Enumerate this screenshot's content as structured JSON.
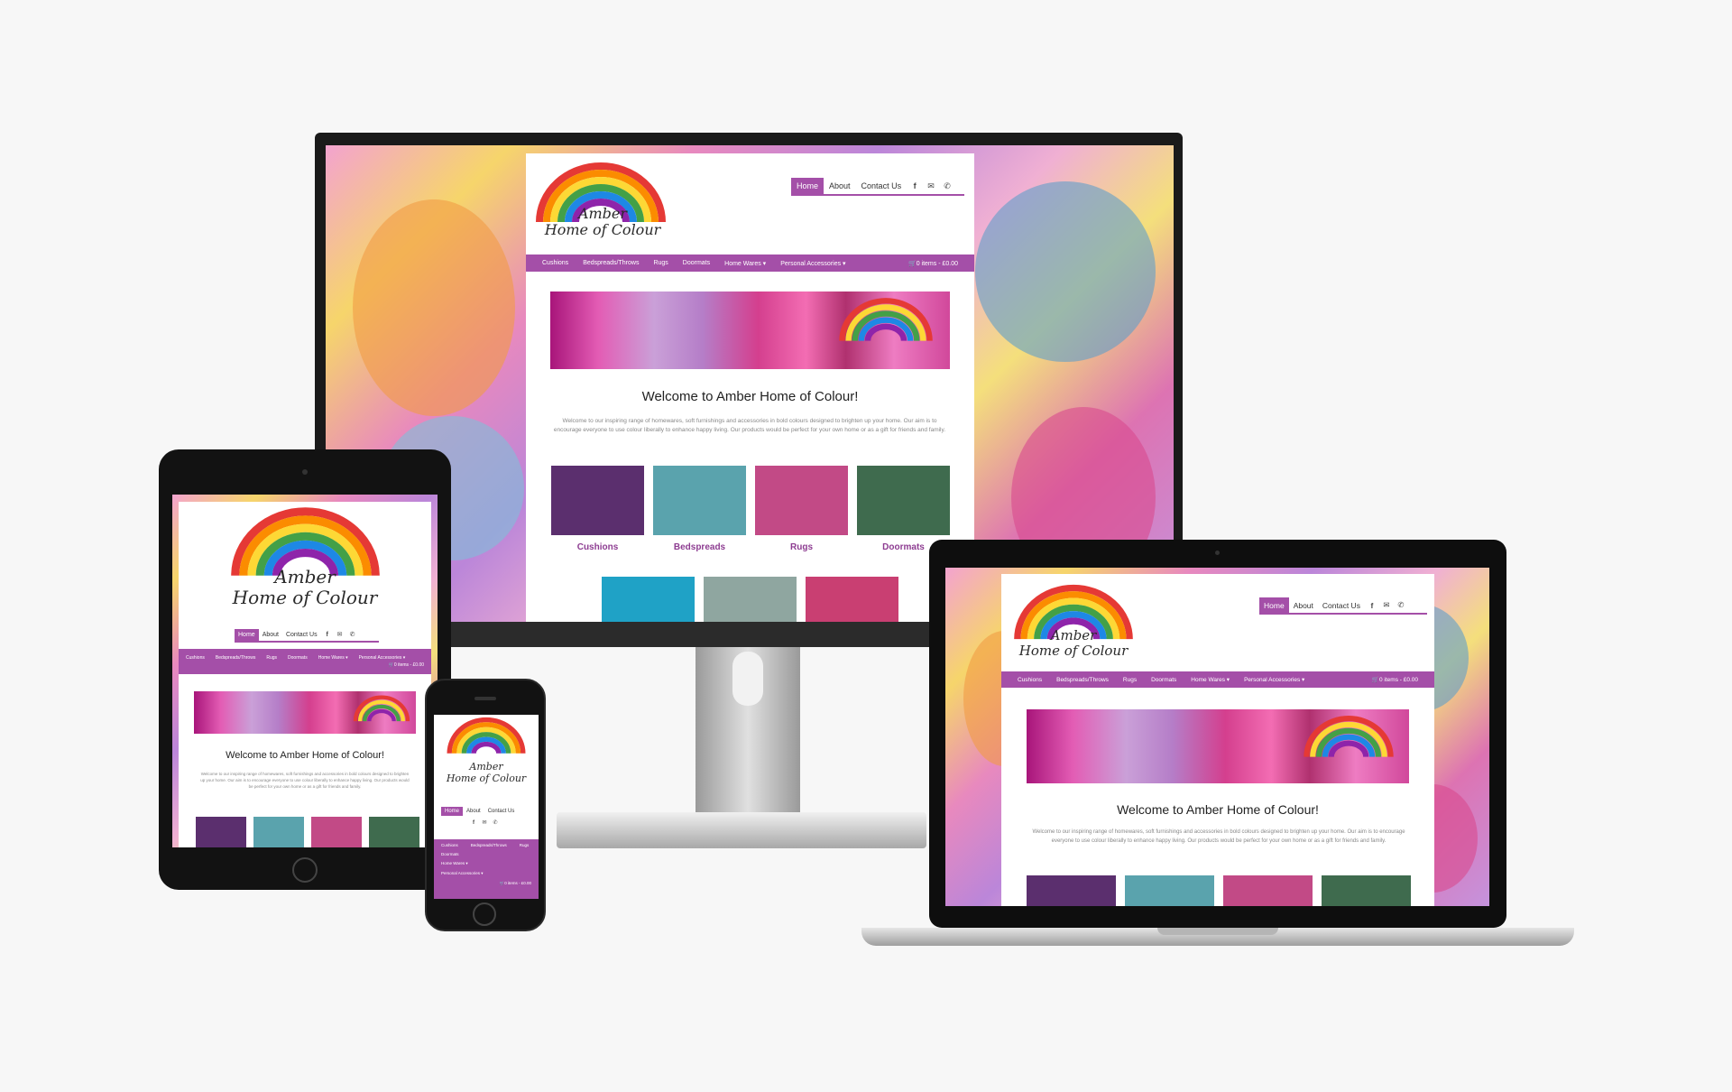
{
  "site": {
    "logo_line1": "Amber",
    "logo_line2": "Home of Colour",
    "nav": [
      {
        "label": "Home",
        "active": true
      },
      {
        "label": "About",
        "active": false
      },
      {
        "label": "Contact Us",
        "active": false
      }
    ],
    "nav_icons": [
      "facebook-icon",
      "envelope-icon",
      "phone-icon"
    ],
    "categories": [
      "Cushions",
      "Bedspreads/Throws",
      "Rugs",
      "Doormats",
      "Home Wares ▾",
      "Personal Accessories ▾"
    ],
    "cart": "🛒0 items - £0.00",
    "welcome_title": "Welcome to Amber Home of Colour!",
    "intro": "Welcome to our inspiring range of homewares, soft furnishings and accessories in bold colours designed to brighten up your home. Our aim is to encourage everyone to use colour liberally to enhance happy living. Our products would be perfect for your own home or as a gift for friends and family.",
    "products": [
      {
        "label": "Cushions",
        "color": "#5b2f6e"
      },
      {
        "label": "Bedspreads",
        "color": "#5aa3ad"
      },
      {
        "label": "Rugs",
        "color": "#c24a86"
      },
      {
        "label": "Doormats",
        "color": "#3f6b4e"
      }
    ],
    "products_row2_colors": [
      "#1fa2c6",
      "#8fa6a0",
      "#c93f72"
    ]
  },
  "colors": {
    "brand_purple": "#a44fa8",
    "label_purple": "#8d3c91",
    "background": "#f7f7f7",
    "bezel": "#121212"
  }
}
